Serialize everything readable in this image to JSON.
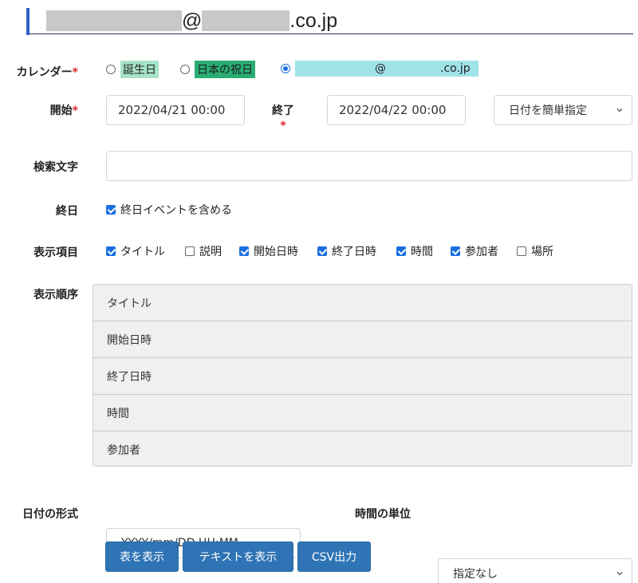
{
  "header": {
    "at": "@",
    "domain_suffix": ".co.jp"
  },
  "calendar": {
    "label": "カレンダー",
    "required_mark": "*",
    "options": [
      {
        "label": "誕生日",
        "selected": false,
        "highlight": "#a6e3c8"
      },
      {
        "label": "日本の祝日",
        "selected": false,
        "highlight": "#2aad74"
      },
      {
        "at": "@",
        "domain_suffix": ".co.jp",
        "selected": true,
        "highlight": "#a0e3e9"
      }
    ]
  },
  "start": {
    "label": "開始",
    "required_mark": "*",
    "value": "2022/04/21 00:00"
  },
  "end": {
    "label": "終了",
    "required_mark": "*",
    "value": "2022/04/22 00:00"
  },
  "date_preset": {
    "selected": "日付を簡単指定"
  },
  "search": {
    "label": "検索文字",
    "value": ""
  },
  "allday": {
    "label": "終日",
    "checkbox_label": "終日イベントを含める",
    "checked": true
  },
  "display_items": {
    "label": "表示項目",
    "items": [
      {
        "label": "タイトル",
        "checked": true
      },
      {
        "label": "説明",
        "checked": false
      },
      {
        "label": "開始日時",
        "checked": true
      },
      {
        "label": "終了日時",
        "checked": true
      },
      {
        "label": "時間",
        "checked": true
      },
      {
        "label": "参加者",
        "checked": true
      },
      {
        "label": "場所",
        "checked": false
      }
    ]
  },
  "display_order": {
    "label": "表示順序",
    "items": [
      "タイトル",
      "開始日時",
      "終了日時",
      "時間",
      "参加者"
    ]
  },
  "date_format": {
    "label": "日付の形式",
    "selected": "YYYY/mm/DD HH:MM"
  },
  "time_unit": {
    "label": "時間の単位",
    "selected": "指定なし"
  },
  "buttons": {
    "table": "表を表示",
    "text": "テキストを表示",
    "csv": "CSV出力"
  },
  "colors": {
    "accent": "#2f74b5",
    "required": "#d9262d",
    "header_bar": "#2f63c8"
  }
}
